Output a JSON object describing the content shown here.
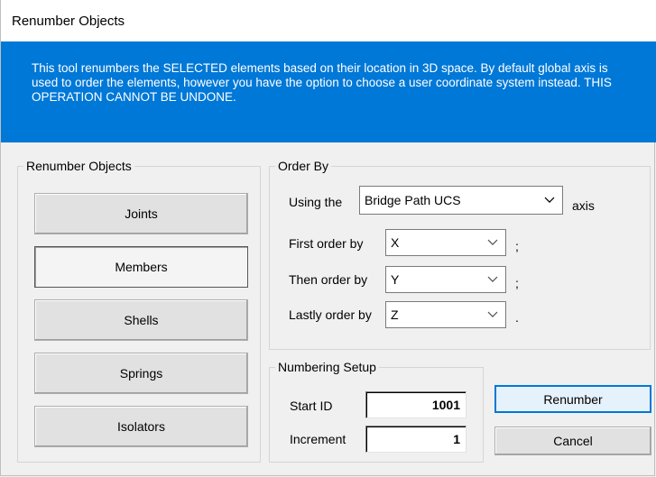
{
  "window": {
    "title": "Renumber Objects"
  },
  "info": {
    "text": "This tool renumbers the SELECTED elements based on their location in 3D space. By default global axis is used to order the elements, however you have the option to choose a user coordinate system instead. THIS OPERATION CANNOT BE UNDONE."
  },
  "renumber_objects": {
    "legend": "Renumber Objects",
    "buttons": [
      {
        "label": "Joints",
        "pressed": false
      },
      {
        "label": "Members",
        "pressed": true
      },
      {
        "label": "Shells",
        "pressed": false
      },
      {
        "label": "Springs",
        "pressed": false
      },
      {
        "label": "Isolators",
        "pressed": false
      }
    ]
  },
  "order_by": {
    "legend": "Order By",
    "using_label": "Using the",
    "ucs_value": "Bridge Path UCS",
    "axis_label": "axis",
    "first_label": "First order by",
    "first_value": "X",
    "first_suffix": ";",
    "then_label": "Then order by",
    "then_value": "Y",
    "then_suffix": ";",
    "last_label": "Lastly order by",
    "last_value": "Z",
    "last_suffix": "."
  },
  "numbering": {
    "legend": "Numbering Setup",
    "start_label": "Start ID",
    "start_value": "1001",
    "increment_label": "Increment",
    "increment_value": "1"
  },
  "actions": {
    "renumber_label": "Renumber",
    "cancel_label": "Cancel"
  },
  "colors": {
    "info_bg": "#0078d7",
    "window_bg": "#f0f0f0"
  },
  "icons": {
    "dropdown": "chevron-down-icon"
  }
}
